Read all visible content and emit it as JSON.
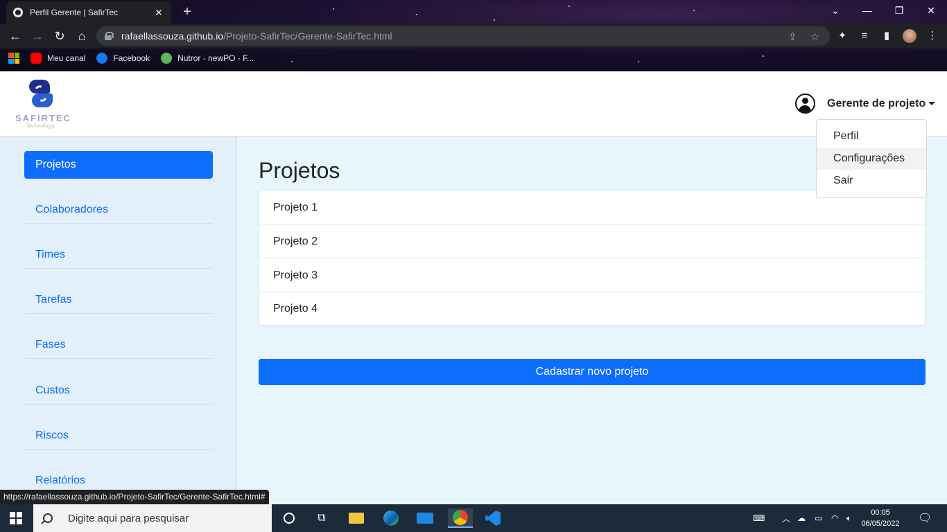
{
  "browser": {
    "tab_title": "Perfil Gerente | SafirTec",
    "tab_close": "✕",
    "new_tab": "+",
    "url_host": "rafaellassouza.github.io",
    "url_path": "/Projeto-SafirTec/Gerente-SafirTec.html",
    "bookmarks": [
      {
        "label": "Meu canal",
        "icon": "youtube-icon",
        "color": "#ff0000"
      },
      {
        "label": "Facebook",
        "icon": "facebook-icon",
        "color": "#1877f2"
      },
      {
        "label": "Nutror - newPO - F...",
        "icon": "nutror-icon",
        "color": "#5cb85c"
      }
    ],
    "status_url": "https://rafaellassouza.github.io/Projeto-SafirTec/Gerente-SafirTec.html#"
  },
  "header": {
    "logo_text": "SAFIRTEC",
    "logo_sub": "Technology",
    "user_name": "Gerente de projeto"
  },
  "dropdown": {
    "items": [
      "Perfil",
      "Configurações",
      "Sair"
    ]
  },
  "sidebar": {
    "items": [
      "Projetos",
      "Colaboradores",
      "Times",
      "Tarefas",
      "Fases",
      "Custos",
      "Riscos",
      "Relatórios"
    ],
    "active": "Projetos"
  },
  "main": {
    "title": "Projetos",
    "projects": [
      "Projeto 1",
      "Projeto 2",
      "Projeto 3",
      "Projeto 4"
    ],
    "add_button": "Cadastrar novo projeto"
  },
  "taskbar": {
    "search_placeholder": "Digite aqui para pesquisar",
    "time": "00:05",
    "date": "06/05/2022"
  },
  "colors": {
    "primary": "#0d6efd",
    "page_bg": "#e7f5fc",
    "sidebar_bg": "#e3effb"
  }
}
